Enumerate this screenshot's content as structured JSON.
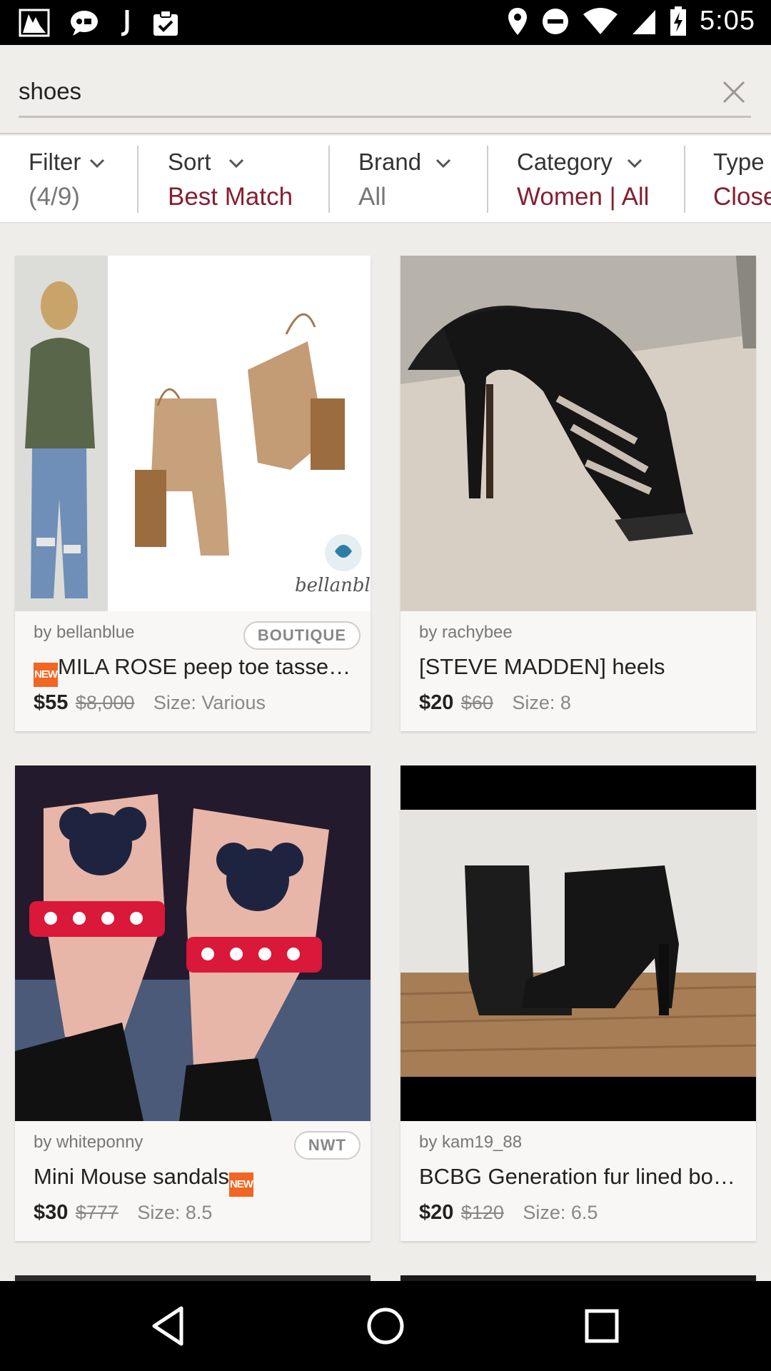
{
  "status_bar": {
    "time": "5:05",
    "left_icons": [
      "photo-notification-icon",
      "chat-notification-icon",
      "j-app-notification-icon",
      "clipboard-check-notification-icon"
    ],
    "right_icons": [
      "location-icon",
      "do-not-disturb-icon",
      "wifi-icon",
      "cell-signal-icon",
      "battery-charging-icon"
    ]
  },
  "search": {
    "query": "shoes"
  },
  "filters": [
    {
      "label": "Filter",
      "value": "(4/9)",
      "value_style": "gray"
    },
    {
      "label": "Sort",
      "value": "Best Match",
      "value_style": "red"
    },
    {
      "label": "Brand",
      "value": "All",
      "value_style": "gray"
    },
    {
      "label": "Category",
      "value": "Women | All",
      "value_style": "red"
    },
    {
      "label": "Type",
      "value": "Closet",
      "value_style": "red"
    }
  ],
  "listings": [
    {
      "seller": "by bellanblue",
      "badge": "BOUTIQUE",
      "new_tag": "NEW",
      "title": "MILA ROSE peep toe tassel booties",
      "price": "$55",
      "original_price": "$8,000",
      "size": "Size: Various",
      "watermark": "bellanbl"
    },
    {
      "seller": "by rachybee",
      "badge": "",
      "title": "[STEVE MADDEN] heels",
      "price": "$20",
      "original_price": "$60",
      "size": "Size: 8"
    },
    {
      "seller": "by whiteponny",
      "badge": "NWT",
      "new_tag": "NEW",
      "title": "Mini Mouse sandals",
      "price": "$30",
      "original_price": "$777",
      "size": "Size: 8.5"
    },
    {
      "seller": "by kam19_88",
      "badge": "",
      "title": "BCBG Generation fur lined booties",
      "price": "$20",
      "original_price": "$120",
      "size": "Size: 6.5"
    }
  ],
  "colors": {
    "accent_red": "#861f32",
    "new_tag_orange": "#f26522",
    "background": "#efedea"
  },
  "nav": {
    "icons": [
      "back-icon",
      "home-icon",
      "recents-icon"
    ]
  }
}
